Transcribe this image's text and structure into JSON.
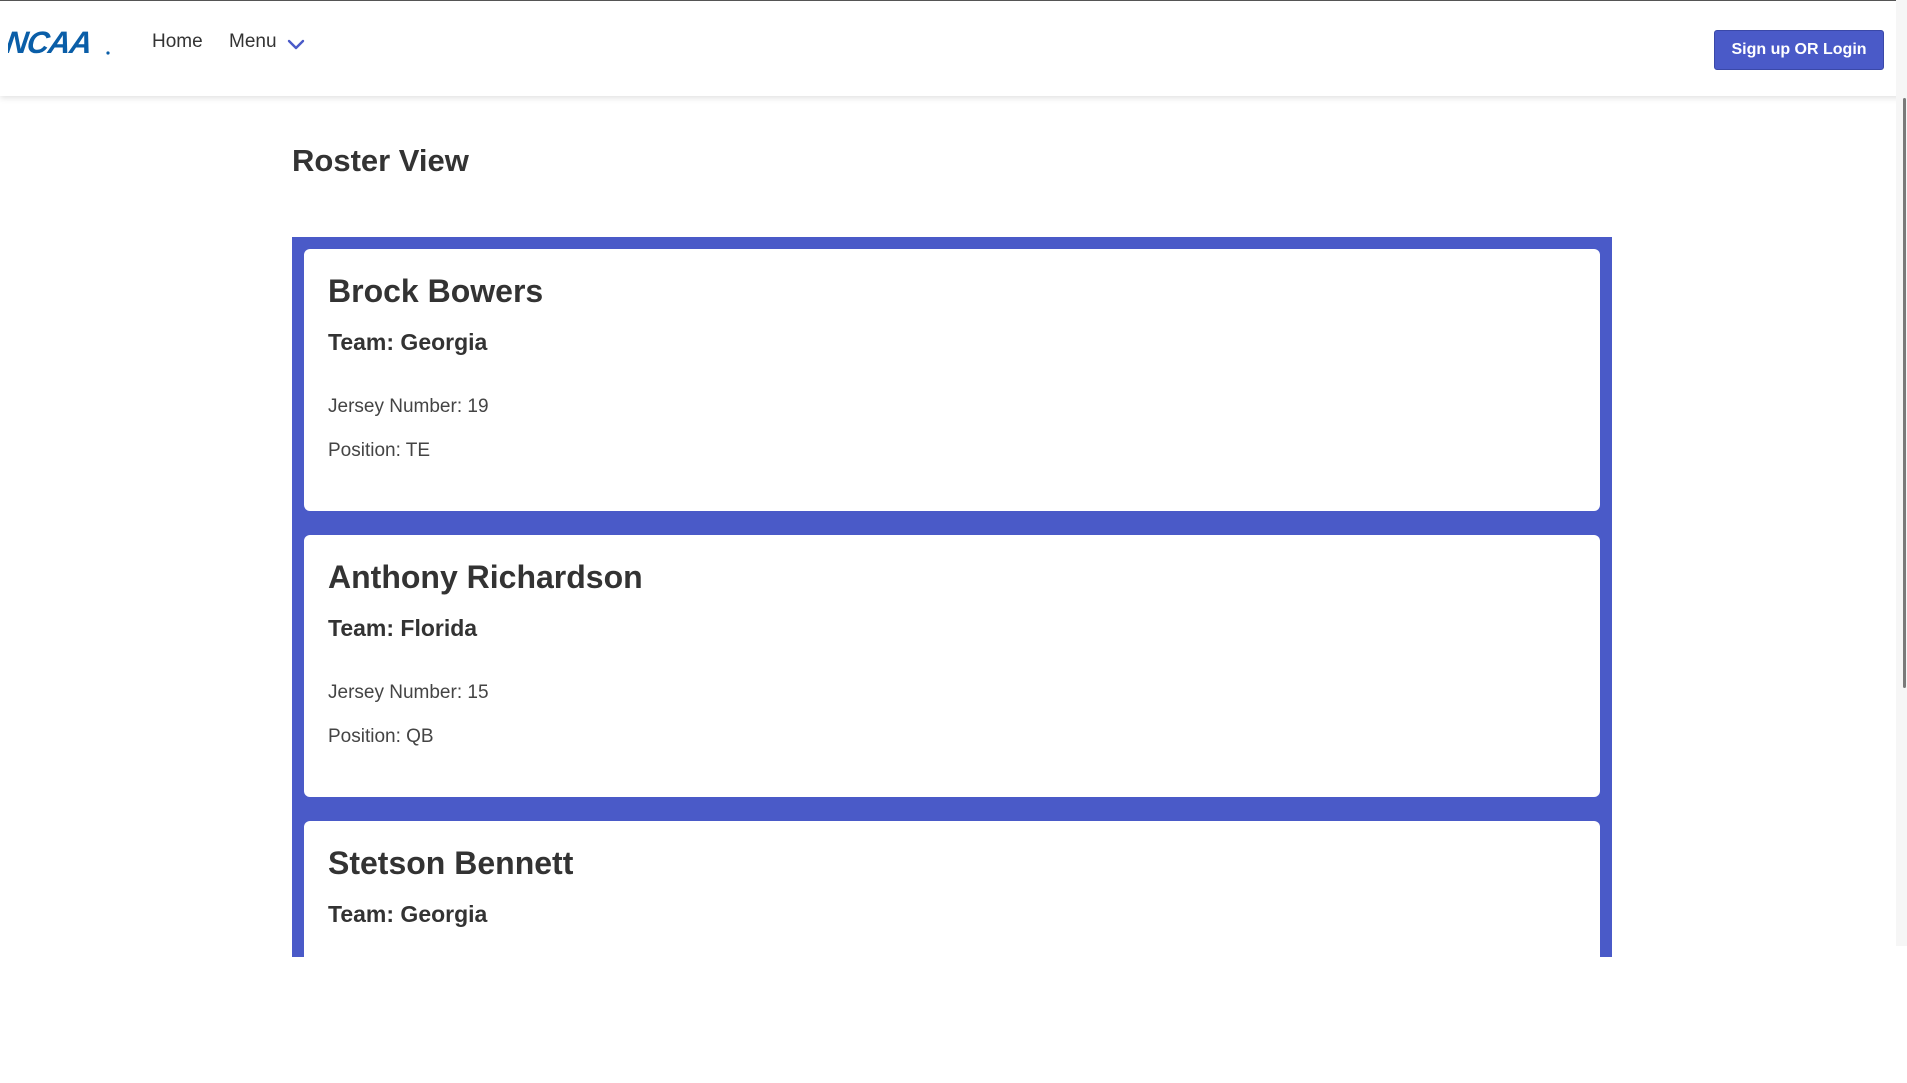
{
  "header": {
    "logo_text": "NCAA",
    "logo_color": "#0a5ea8",
    "nav": {
      "home_label": "Home",
      "menu_label": "Menu",
      "menu_icon": "chevron-down-icon"
    },
    "auth_button_label": "Sign up OR Login"
  },
  "main": {
    "title": "Roster View",
    "players": [
      {
        "name": "Brock Bowers",
        "team": "Team: Georgia",
        "jersey": "Jersey Number: 19",
        "position": "Position: TE"
      },
      {
        "name": "Anthony Richardson",
        "team": "Team: Florida",
        "jersey": "Jersey Number: 15",
        "position": "Position: QB"
      },
      {
        "name": "Stetson Bennett",
        "team": "Team: Georgia",
        "jersey": "",
        "position": ""
      }
    ]
  },
  "colors": {
    "accent": "#4a5ac8",
    "text": "#333333",
    "background": "#ffffff"
  }
}
